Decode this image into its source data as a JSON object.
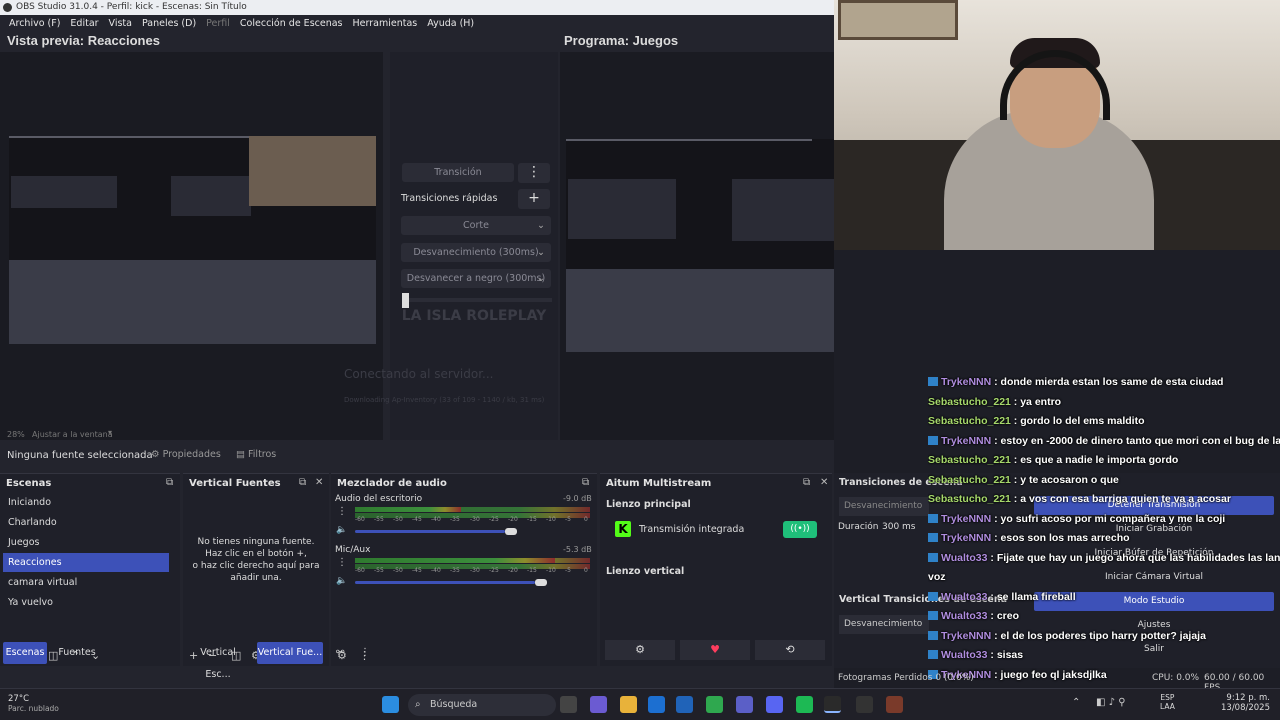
{
  "window": {
    "title": "OBS Studio 31.0.4 - Perfil: kick - Escenas: Sin Título"
  },
  "menu": [
    {
      "label": "Archivo (F)"
    },
    {
      "label": "Editar"
    },
    {
      "label": "Vista"
    },
    {
      "label": "Paneles (D)"
    },
    {
      "label": "Perfil"
    },
    {
      "label": "Colección de Escenas"
    },
    {
      "label": "Herramientas"
    },
    {
      "label": "Ayuda (H)"
    }
  ],
  "preview": {
    "title": "Vista previa: Reacciones",
    "zoom": "28%",
    "zoom_option": "Ajustar a la ventana"
  },
  "program": {
    "title": "Programa: Juegos"
  },
  "transitions": {
    "button": "Transición",
    "quick": "Transiciones rápidas",
    "items": [
      "Corte",
      "Desvanecimiento (300ms)",
      "Desvanecer a negro (300ms)"
    ],
    "overlay_text": "LA ISLA ROLEPLAY",
    "connecting": "Conectando al servidor...",
    "downloading": "Downloading Ap-Inventory (33 of 109 - 1140 / kb, 31 ms)"
  },
  "sourcebar": {
    "no_source": "Ninguna fuente seleccionada",
    "properties": "Propiedades",
    "filters": "Filtros"
  },
  "scenes": {
    "title": "Escenas",
    "items": [
      "Iniciando",
      "Charlando",
      "Juegos",
      "Reacciones",
      "camara virtual",
      "Ya vuelvo"
    ],
    "selected": "Reacciones"
  },
  "vertical_sources": {
    "title": "Vertical Fuentes",
    "empty": "No tienes ninguna fuente.\nHaz clic en el botón +,\no haz clic derecho aquí para añadir una."
  },
  "mixer": {
    "title": "Mezclador de audio",
    "channels": [
      {
        "name": "Audio del escritorio",
        "db": "-9.0 dB",
        "level": 0.45,
        "volume": 0.75
      },
      {
        "name": "Mic/Aux",
        "db": "-5.3 dB",
        "level": 0.85,
        "volume": 0.9
      }
    ],
    "ticks": [
      "-60",
      "-55",
      "-50",
      "-45",
      "-40",
      "-35",
      "-30",
      "-25",
      "-20",
      "-15",
      "-10",
      "-5",
      "0"
    ]
  },
  "multistream": {
    "title": "Aitum Multistream",
    "main_canvas": "Lienzo principal",
    "integrated": "Transmisión integrada",
    "vertical_canvas": "Lienzo vertical"
  },
  "studio_transitions": {
    "title": "Transiciones de escena",
    "item": "Desvanecimiento",
    "duration_label": "Duración",
    "duration": "300 ms"
  },
  "vertical_transitions": {
    "title": "Vertical Transiciones de escena",
    "item": "Desvanecimiento"
  },
  "bottom_tabs": {
    "scenes": "Escenas",
    "sources": "Fuentes",
    "vertical_scenes": "Vertical Esc...",
    "vertical_sources": "Vertical Fue..."
  },
  "controls": [
    "Detener Transmisión",
    "Iniciar Grabación",
    "Iniciar Búfer de Repetición",
    "Iniciar Cámara Virtual",
    "Modo Estudio",
    "Ajustes",
    "Salir"
  ],
  "status": {
    "frames": "Fotogramas Perdidos 0 (0.0%)",
    "cpu": "CPU: 0.0%",
    "fps": "60.00 / 60.00 FPS"
  },
  "chat": [
    {
      "user": "TrykeNNN",
      "msg": "donde mierda estan los same de esta ciudad",
      "badge": true
    },
    {
      "user": "Sebastucho_221",
      "msg": "ya entro",
      "badge": false
    },
    {
      "user": "Sebastucho_221",
      "msg": "gordo lo del ems maldito",
      "badge": false
    },
    {
      "user": "TrykeNNN",
      "msg": "estoy en -2000 de dinero tanto que mori con el bug de la",
      "badge": true
    },
    {
      "user": "Sebastucho_221",
      "msg": "es que a nadie le importa gordo",
      "badge": false
    },
    {
      "user": "Sebastucho_221",
      "msg": "y te acosaron o que",
      "badge": false
    },
    {
      "user": "Sebastucho_221",
      "msg": "a vos con esa barriga quien te va a acosar",
      "badge": false
    },
    {
      "user": "TrykeNNN",
      "msg": "yo sufri acoso por mi compañera y me la coji",
      "badge": true
    },
    {
      "user": "TrykeNNN",
      "msg": "esos son los mas arrecho",
      "badge": true
    },
    {
      "user": "Wualto33",
      "msg": "Fijate que hay un juego ahora que las habilidades las lanz",
      "badge": true
    },
    {
      "user": "",
      "msg": "voz",
      "badge": false
    },
    {
      "user": "Wualto33",
      "msg": "se llama fireball",
      "badge": true
    },
    {
      "user": "Wualto33",
      "msg": "creo",
      "badge": true
    },
    {
      "user": "TrykeNNN",
      "msg": "el de los poderes tipo harry potter? jajaja",
      "badge": true
    },
    {
      "user": "Wualto33",
      "msg": "sisas",
      "badge": true
    },
    {
      "user": "TrykeNNN",
      "msg": "juego feo ql jaksdjlka",
      "badge": true
    }
  ],
  "taskbar": {
    "temp": "27°C",
    "weather": "Parc. nublado",
    "search": "Búsqueda",
    "lang1": "ESP",
    "lang2": "LAA",
    "time": "9:12 p. m.",
    "date": "13/08/2025"
  }
}
